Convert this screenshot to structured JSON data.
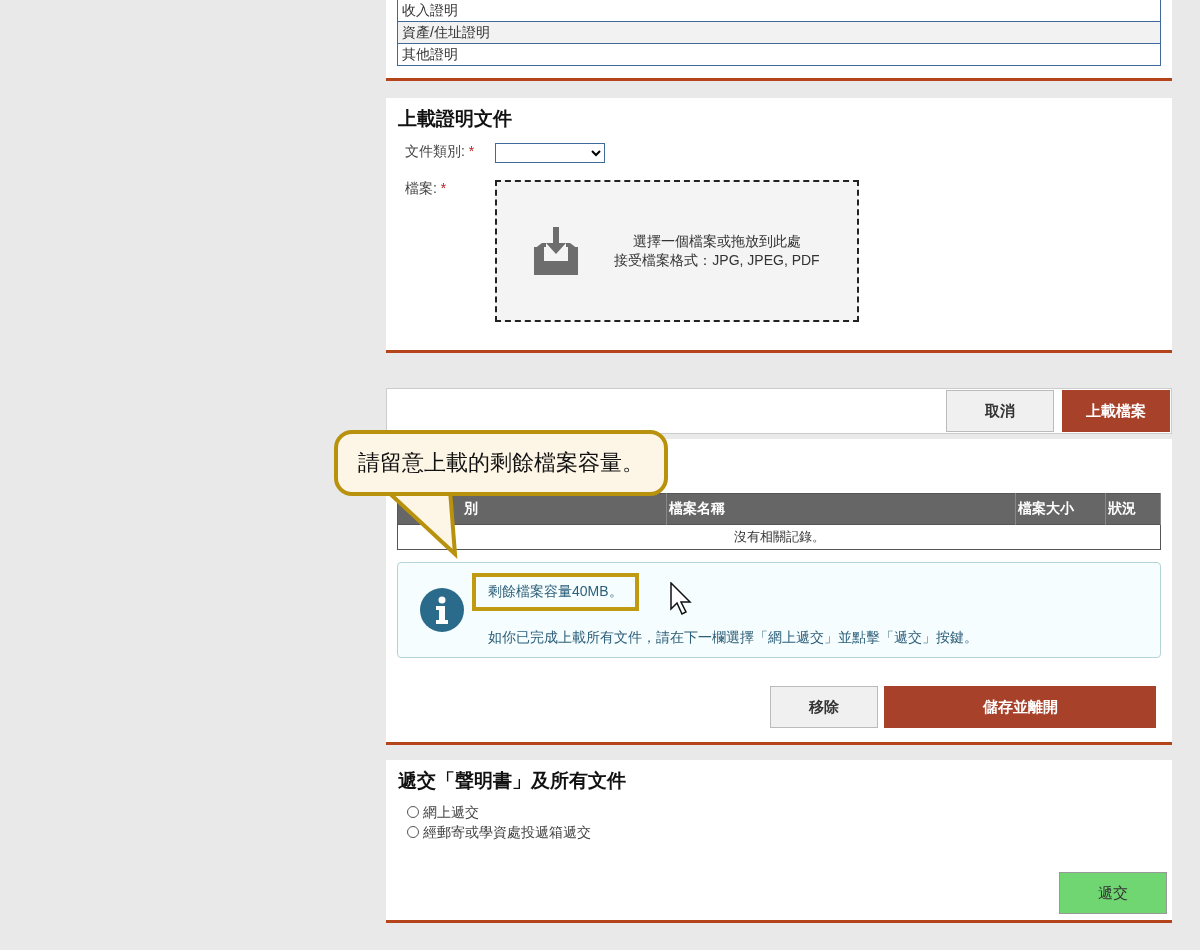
{
  "document_list": [
    "收入證明",
    "資產/住址證明",
    "其他證明"
  ],
  "upload_section": {
    "title": "上載證明文件",
    "category_label": "文件類別:",
    "category_required": "*",
    "file_label": "檔案:",
    "file_required": "*",
    "dropzone_text": "選擇一個檔案或拖放到此處",
    "dropzone_formats": "接受檔案格式：JPG, JPEG, PDF"
  },
  "upload_actions": [
    "取消",
    "上載檔案"
  ],
  "callout": "請留意上載的剩餘檔案容量。",
  "files_table": {
    "columns": [
      "別",
      "檔案名稱",
      "檔案大小",
      "狀況"
    ],
    "empty_message": "沒有相關記錄。"
  },
  "info_box": {
    "remaining": "剩餘檔案容量40MB。",
    "highlighted": true,
    "instruction": "如你已完成上載所有文件，請在下一欄選擇「網上遞交」並點擊「遞交」按鍵。"
  },
  "file_actions": [
    "移除",
    "儲存並離開"
  ],
  "submit_section": {
    "title": "遞交「聲明書」及所有文件",
    "options": [
      {
        "label": "網上遞交",
        "selected": false
      },
      {
        "label": "經郵寄或學資處投遞箱遞交",
        "selected": false
      }
    ],
    "button": "遞交"
  }
}
